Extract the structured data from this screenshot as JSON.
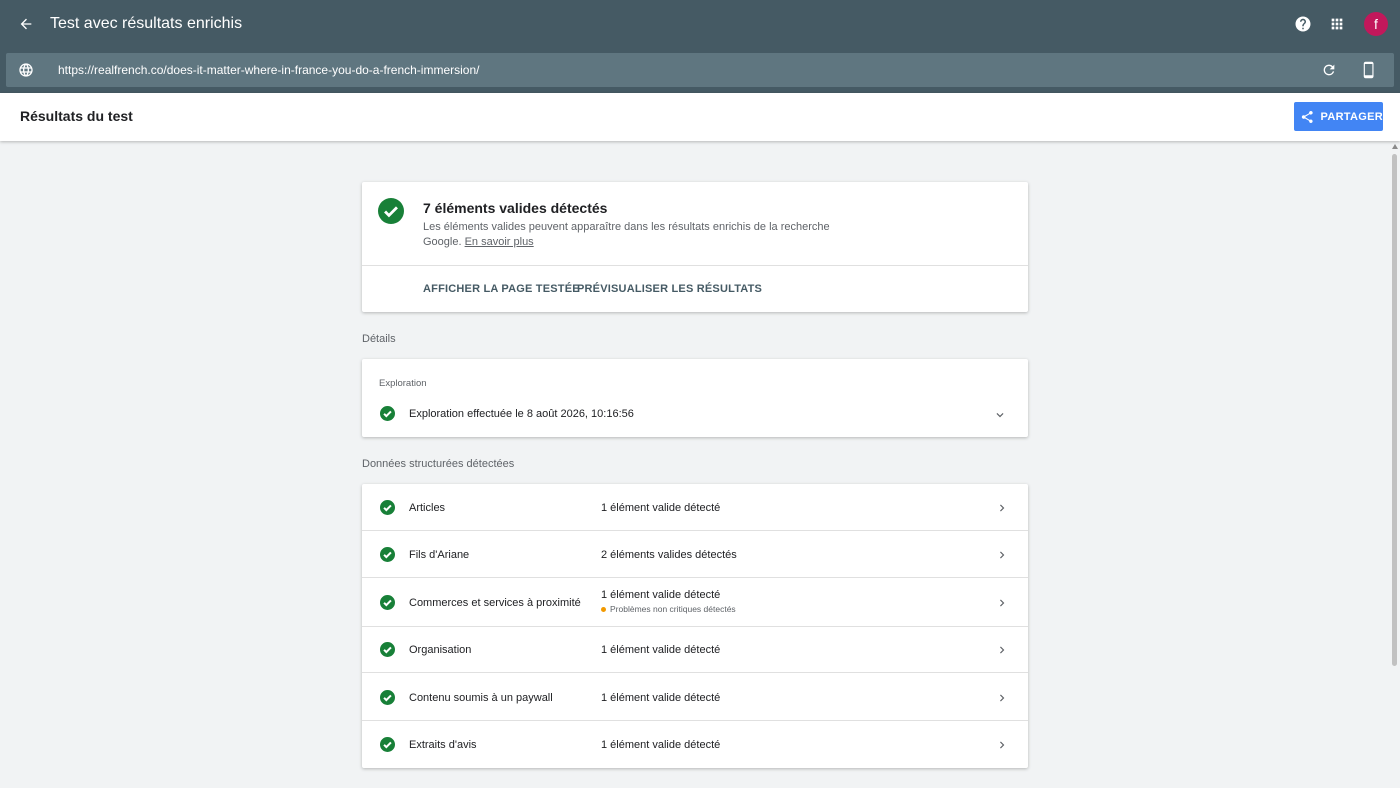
{
  "app": {
    "title": "Test avec résultats enrichis",
    "avatar_letter": "f"
  },
  "urlbar": {
    "url": "https://realfrench.co/does-it-matter-where-in-france-you-do-a-french-immersion/"
  },
  "subheader": {
    "title": "Résultats du test",
    "share_label": "PARTAGER"
  },
  "summary": {
    "title": "7 éléments valides détectés",
    "description": "Les éléments valides peuvent apparaître dans les résultats enrichis de la recherche Google.",
    "learn_more": "En savoir plus",
    "action_view_page": "AFFICHER LA PAGE TESTÉE",
    "action_preview": "PRÉVISUALISER LES RÉSULTATS"
  },
  "details": {
    "section_label": "Détails",
    "crawl_label": "Exploration",
    "crawl_status": "Exploration effectuée le 8 août 2026, 10:16:56"
  },
  "structured": {
    "section_label": "Données structurées détectées",
    "rows": [
      {
        "name": "Articles",
        "status": "1 élément valide détecté"
      },
      {
        "name": "Fils d'Ariane",
        "status": "2 éléments valides détectés"
      },
      {
        "name": "Commerces et services à proximité",
        "status": "1 élément valide détecté",
        "warning": "Problèmes non critiques détectés"
      },
      {
        "name": "Organisation",
        "status": "1 élément valide détecté"
      },
      {
        "name": "Contenu soumis à un paywall",
        "status": "1 élément valide détecté"
      },
      {
        "name": "Extraits d'avis",
        "status": "1 élément valide détecté"
      }
    ]
  },
  "colors": {
    "appbar": "#455a64",
    "success": "#188038",
    "accent": "#4285f4",
    "warning": "#f29900",
    "avatar": "#c2185b"
  },
  "icons": [
    "arrow-back-icon",
    "help-icon",
    "apps-grid-icon",
    "globe-icon",
    "refresh-icon",
    "phone-icon",
    "share-icon",
    "check-circle-icon",
    "chevron-down-icon",
    "chevron-right-icon"
  ]
}
